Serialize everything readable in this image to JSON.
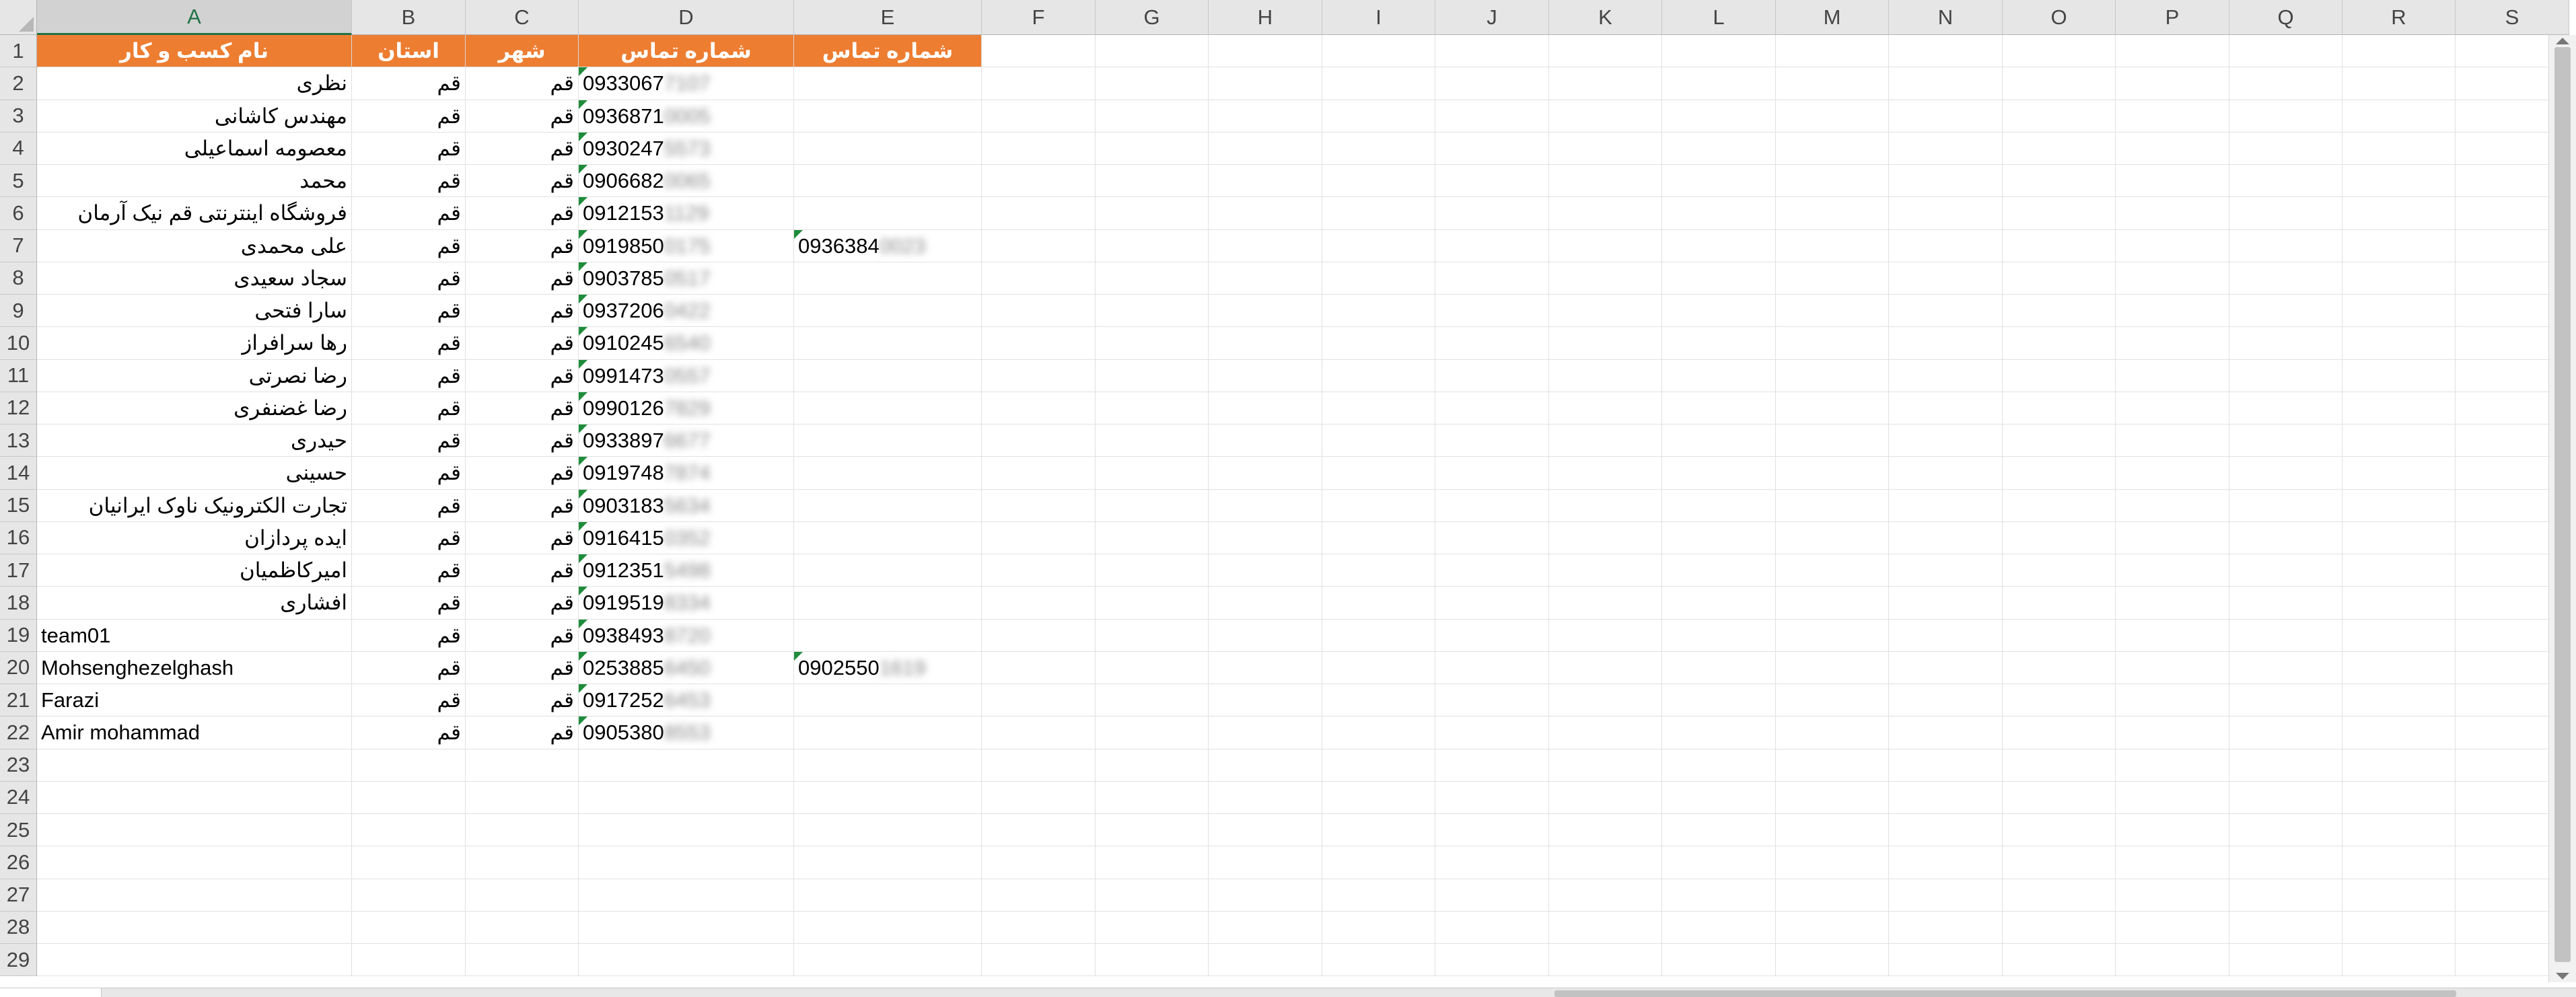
{
  "columns": [
    "A",
    "B",
    "C",
    "D",
    "E",
    "F",
    "G",
    "H",
    "I",
    "J",
    "K",
    "L",
    "M",
    "N",
    "O",
    "P",
    "Q",
    "R",
    "S"
  ],
  "selected_column": "A",
  "header_row": [
    "نام کسب و کار",
    "استان",
    "شهر",
    "شماره تماس",
    "شماره تماس"
  ],
  "rows": [
    {
      "name": "نظری",
      "province": "قم",
      "city": "قم",
      "phone_prefix": "0933067",
      "phone_masked": "7107",
      "phone2_prefix": "",
      "phone2_masked": ""
    },
    {
      "name": "مهندس کاشانی",
      "province": "قم",
      "city": "قم",
      "phone_prefix": "0936871",
      "phone_masked": "0005",
      "phone2_prefix": "",
      "phone2_masked": ""
    },
    {
      "name": "معصومه اسماعیلی",
      "province": "قم",
      "city": "قم",
      "phone_prefix": "0930247",
      "phone_masked": "5573",
      "phone2_prefix": "",
      "phone2_masked": ""
    },
    {
      "name": "محمد",
      "province": "قم",
      "city": "قم",
      "phone_prefix": "0906682",
      "phone_masked": "0065",
      "phone2_prefix": "",
      "phone2_masked": ""
    },
    {
      "name": "فروشگاه اینترنتی قم نیک آرمان",
      "province": "قم",
      "city": "قم",
      "phone_prefix": "0912153",
      "phone_masked": "1129",
      "phone2_prefix": "",
      "phone2_masked": ""
    },
    {
      "name": "علی محمدی",
      "province": "قم",
      "city": "قم",
      "phone_prefix": "0919850",
      "phone_masked": "0175",
      "phone2_prefix": "0936384",
      "phone2_masked": "0023"
    },
    {
      "name": "سجاد سعیدی",
      "province": "قم",
      "city": "قم",
      "phone_prefix": "0903785",
      "phone_masked": "0517",
      "phone2_prefix": "",
      "phone2_masked": ""
    },
    {
      "name": "سارا فتحی",
      "province": "قم",
      "city": "قم",
      "phone_prefix": "0937206",
      "phone_masked": "0422",
      "phone2_prefix": "",
      "phone2_masked": ""
    },
    {
      "name": "رها سرافراز",
      "province": "قم",
      "city": "قم",
      "phone_prefix": "0910245",
      "phone_masked": "6540",
      "phone2_prefix": "",
      "phone2_masked": ""
    },
    {
      "name": "رضا نصرتی",
      "province": "قم",
      "city": "قم",
      "phone_prefix": "0991473",
      "phone_masked": "0557",
      "phone2_prefix": "",
      "phone2_masked": ""
    },
    {
      "name": "رضا غضنفری",
      "province": "قم",
      "city": "قم",
      "phone_prefix": "0990126",
      "phone_masked": "7829",
      "phone2_prefix": "",
      "phone2_masked": ""
    },
    {
      "name": "حیدری",
      "province": "قم",
      "city": "قم",
      "phone_prefix": "0933897",
      "phone_masked": "6677",
      "phone2_prefix": "",
      "phone2_masked": ""
    },
    {
      "name": "حسینی",
      "province": "قم",
      "city": "قم",
      "phone_prefix": "0919748",
      "phone_masked": "7874",
      "phone2_prefix": "",
      "phone2_masked": ""
    },
    {
      "name": "تجارت الکترونیک ناوک ایرانیان",
      "province": "قم",
      "city": "قم",
      "phone_prefix": "0903183",
      "phone_masked": "5634",
      "phone2_prefix": "",
      "phone2_masked": ""
    },
    {
      "name": "ایده پردازان",
      "province": "قم",
      "city": "قم",
      "phone_prefix": "0916415",
      "phone_masked": "0352",
      "phone2_prefix": "",
      "phone2_masked": ""
    },
    {
      "name": "امیرکاظمیان",
      "province": "قم",
      "city": "قم",
      "phone_prefix": "0912351",
      "phone_masked": "5498",
      "phone2_prefix": "",
      "phone2_masked": ""
    },
    {
      "name": "افشاری",
      "province": "قم",
      "city": "قم",
      "phone_prefix": "0919519",
      "phone_masked": "8334",
      "phone2_prefix": "",
      "phone2_masked": ""
    },
    {
      "name": "team01",
      "province": "قم",
      "city": "قم",
      "phone_prefix": "0938493",
      "phone_masked": "8720",
      "phone2_prefix": "",
      "phone2_masked": ""
    },
    {
      "name": "Mohsenghezelghash",
      "province": "قم",
      "city": "قم",
      "phone_prefix": "0253885",
      "phone_masked": "6450",
      "phone2_prefix": "0902550",
      "phone2_masked": "1619"
    },
    {
      "name": "Farazi",
      "province": "قم",
      "city": "قم",
      "phone_prefix": "0917252",
      "phone_masked": "6453",
      "phone2_prefix": "",
      "phone2_masked": ""
    },
    {
      "name": "Amir mohammad",
      "province": "قم",
      "city": "قم",
      "phone_prefix": "0905380",
      "phone_masked": "8553",
      "phone2_prefix": "",
      "phone2_masked": ""
    }
  ],
  "colors": {
    "header_fill": "#ed7d31",
    "header_text": "#ffffff",
    "selection_accent": "#217346",
    "text_flag": "#1f8c3b"
  }
}
